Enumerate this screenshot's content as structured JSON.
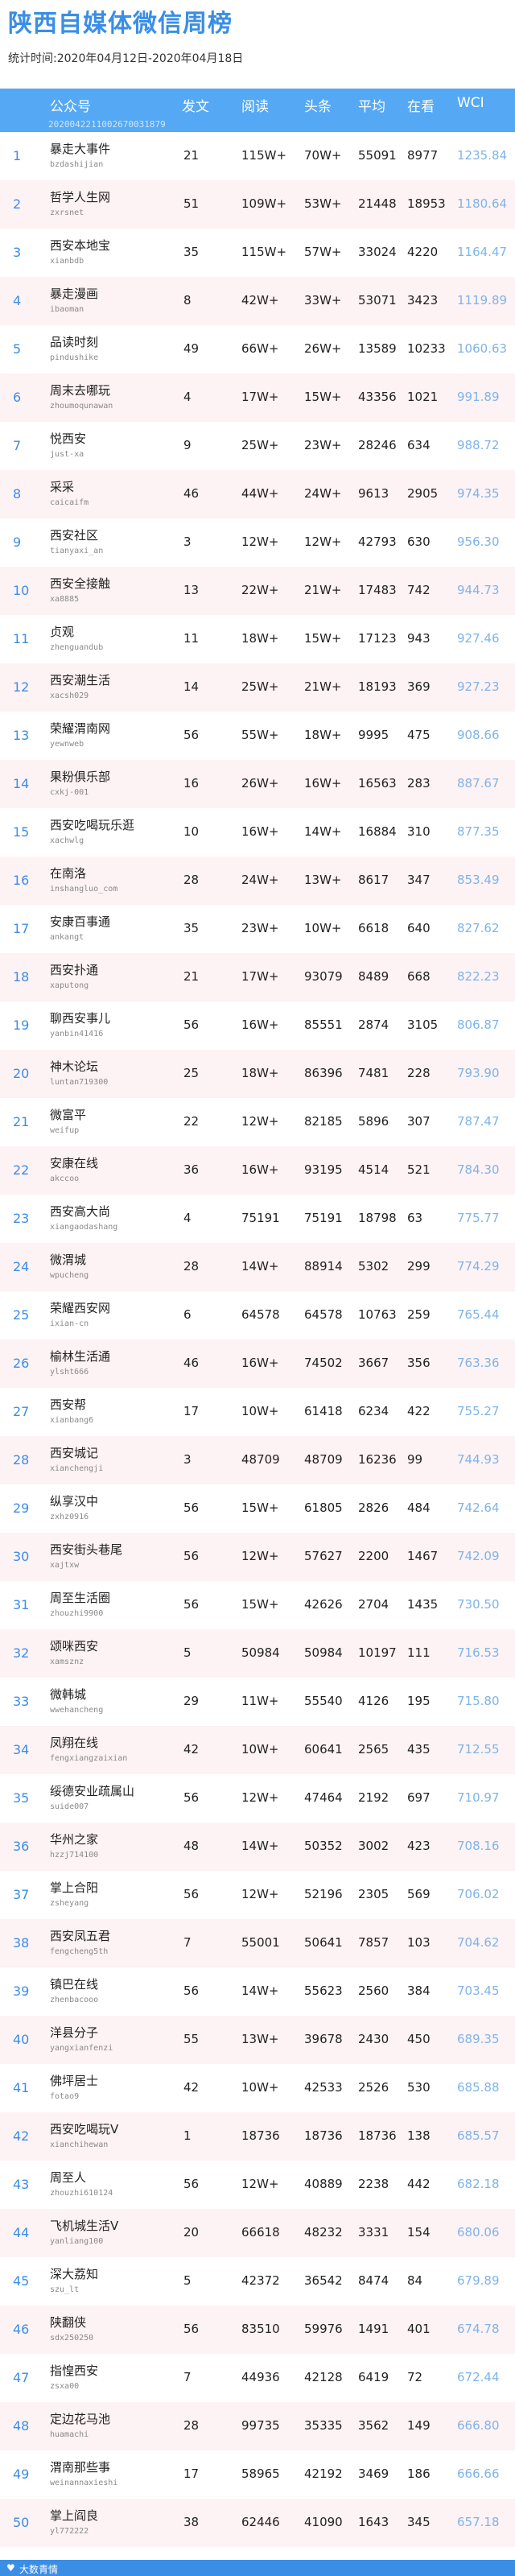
{
  "header": {
    "title": "陕西自媒体微信周榜",
    "period": "统计时间:2020年04月12日-2020年04月18日"
  },
  "table": {
    "columns": {
      "account": "公众号",
      "posts": "发文",
      "reads": "阅读",
      "headline": "头条",
      "average": "平均",
      "watching": "在看",
      "wci": "WCI"
    },
    "code": "2020042211002670031879",
    "rows": [
      {
        "rank": "1",
        "name": "暴走大事件",
        "account": "bzdashijian",
        "posts": "21",
        "reads": "115W+",
        "headline": "70W+",
        "average": "55091",
        "watching": "8977",
        "wci": "1235.84"
      },
      {
        "rank": "2",
        "name": "哲学人生网",
        "account": "zxrsnet",
        "posts": "51",
        "reads": "109W+",
        "headline": "53W+",
        "average": "21448",
        "watching": "18953",
        "wci": "1180.64"
      },
      {
        "rank": "3",
        "name": "西安本地宝",
        "account": "xianbdb",
        "posts": "35",
        "reads": "115W+",
        "headline": "57W+",
        "average": "33024",
        "watching": "4220",
        "wci": "1164.47"
      },
      {
        "rank": "4",
        "name": "暴走漫画",
        "account": "ibaoman",
        "posts": "8",
        "reads": "42W+",
        "headline": "33W+",
        "average": "53071",
        "watching": "3423",
        "wci": "1119.89"
      },
      {
        "rank": "5",
        "name": "品读时刻",
        "account": "pindushike",
        "posts": "49",
        "reads": "66W+",
        "headline": "26W+",
        "average": "13589",
        "watching": "10233",
        "wci": "1060.63"
      },
      {
        "rank": "6",
        "name": "周末去哪玩",
        "account": "zhoumoqunawan",
        "posts": "4",
        "reads": "17W+",
        "headline": "15W+",
        "average": "43356",
        "watching": "1021",
        "wci": "991.89"
      },
      {
        "rank": "7",
        "name": "悦西安",
        "account": "just-xa",
        "posts": "9",
        "reads": "25W+",
        "headline": "23W+",
        "average": "28246",
        "watching": "634",
        "wci": "988.72"
      },
      {
        "rank": "8",
        "name": "采采",
        "account": "caicaifm",
        "posts": "46",
        "reads": "44W+",
        "headline": "24W+",
        "average": "9613",
        "watching": "2905",
        "wci": "974.35"
      },
      {
        "rank": "9",
        "name": "西安社区",
        "account": "tianyaxi_an",
        "posts": "3",
        "reads": "12W+",
        "headline": "12W+",
        "average": "42793",
        "watching": "630",
        "wci": "956.30"
      },
      {
        "rank": "10",
        "name": "西安全接触",
        "account": "xa8885",
        "posts": "13",
        "reads": "22W+",
        "headline": "21W+",
        "average": "17483",
        "watching": "742",
        "wci": "944.73"
      },
      {
        "rank": "11",
        "name": "贞观",
        "account": "zhenguandub",
        "posts": "11",
        "reads": "18W+",
        "headline": "15W+",
        "average": "17123",
        "watching": "943",
        "wci": "927.46"
      },
      {
        "rank": "12",
        "name": "西安潮生活",
        "account": "xacsh029",
        "posts": "14",
        "reads": "25W+",
        "headline": "21W+",
        "average": "18193",
        "watching": "369",
        "wci": "927.23"
      },
      {
        "rank": "13",
        "name": "荣耀渭南网",
        "account": "yewnweb",
        "posts": "56",
        "reads": "55W+",
        "headline": "18W+",
        "average": "9995",
        "watching": "475",
        "wci": "908.66"
      },
      {
        "rank": "14",
        "name": "果粉俱乐部",
        "account": "cxkj-001",
        "posts": "16",
        "reads": "26W+",
        "headline": "16W+",
        "average": "16563",
        "watching": "283",
        "wci": "887.67"
      },
      {
        "rank": "15",
        "name": "西安吃喝玩乐逛",
        "account": "xachwlg",
        "posts": "10",
        "reads": "16W+",
        "headline": "14W+",
        "average": "16884",
        "watching": "310",
        "wci": "877.35"
      },
      {
        "rank": "16",
        "name": "在南洛",
        "account": "inshangluo_com",
        "posts": "28",
        "reads": "24W+",
        "headline": "13W+",
        "average": "8617",
        "watching": "347",
        "wci": "853.49"
      },
      {
        "rank": "17",
        "name": "安康百事通",
        "account": "ankangt",
        "posts": "35",
        "reads": "23W+",
        "headline": "10W+",
        "average": "6618",
        "watching": "640",
        "wci": "827.62"
      },
      {
        "rank": "18",
        "name": "西安扑通",
        "account": "xaputong",
        "posts": "21",
        "reads": "17W+",
        "headline": "93079",
        "average": "8489",
        "watching": "668",
        "wci": "822.23"
      },
      {
        "rank": "19",
        "name": "聊西安事儿",
        "account": "yanbin41416",
        "posts": "56",
        "reads": "16W+",
        "headline": "85551",
        "average": "2874",
        "watching": "3105",
        "wci": "806.87"
      },
      {
        "rank": "20",
        "name": "神木论坛",
        "account": "luntan719300",
        "posts": "25",
        "reads": "18W+",
        "headline": "86396",
        "average": "7481",
        "watching": "228",
        "wci": "793.90"
      },
      {
        "rank": "21",
        "name": "微富平",
        "account": "weifup",
        "posts": "22",
        "reads": "12W+",
        "headline": "82185",
        "average": "5896",
        "watching": "307",
        "wci": "787.47"
      },
      {
        "rank": "22",
        "name": "安康在线",
        "account": "akccoo",
        "posts": "36",
        "reads": "16W+",
        "headline": "93195",
        "average": "4514",
        "watching": "521",
        "wci": "784.30"
      },
      {
        "rank": "23",
        "name": "西安高大尚",
        "account": "xiangaodashang",
        "posts": "4",
        "reads": "75191",
        "headline": "75191",
        "average": "18798",
        "watching": "63",
        "wci": "775.77"
      },
      {
        "rank": "24",
        "name": "微渭城",
        "account": "wpucheng",
        "posts": "28",
        "reads": "14W+",
        "headline": "88914",
        "average": "5302",
        "watching": "299",
        "wci": "774.29"
      },
      {
        "rank": "25",
        "name": "荣耀西安网",
        "account": "ixian-cn",
        "posts": "6",
        "reads": "64578",
        "headline": "64578",
        "average": "10763",
        "watching": "259",
        "wci": "765.44"
      },
      {
        "rank": "26",
        "name": "榆林生活通",
        "account": "ylsht666",
        "posts": "46",
        "reads": "16W+",
        "headline": "74502",
        "average": "3667",
        "watching": "356",
        "wci": "763.36"
      },
      {
        "rank": "27",
        "name": "西安帮",
        "account": "xianbang6",
        "posts": "17",
        "reads": "10W+",
        "headline": "61418",
        "average": "6234",
        "watching": "422",
        "wci": "755.27"
      },
      {
        "rank": "28",
        "name": "西安城记",
        "account": "xianchengji",
        "posts": "3",
        "reads": "48709",
        "headline": "48709",
        "average": "16236",
        "watching": "99",
        "wci": "744.93"
      },
      {
        "rank": "29",
        "name": "纵享汉中",
        "account": "zxhz0916",
        "posts": "56",
        "reads": "15W+",
        "headline": "61805",
        "average": "2826",
        "watching": "484",
        "wci": "742.64"
      },
      {
        "rank": "30",
        "name": "西安街头巷尾",
        "account": "xajtxw",
        "posts": "56",
        "reads": "12W+",
        "headline": "57627",
        "average": "2200",
        "watching": "1467",
        "wci": "742.09"
      },
      {
        "rank": "31",
        "name": "周至生活圈",
        "account": "zhouzhi9900",
        "posts": "56",
        "reads": "15W+",
        "headline": "42626",
        "average": "2704",
        "watching": "1435",
        "wci": "730.50"
      },
      {
        "rank": "32",
        "name": "颂咪西安",
        "account": "xamsznz",
        "posts": "5",
        "reads": "50984",
        "headline": "50984",
        "average": "10197",
        "watching": "111",
        "wci": "716.53"
      },
      {
        "rank": "33",
        "name": "微韩城",
        "account": "wwehancheng",
        "posts": "29",
        "reads": "11W+",
        "headline": "55540",
        "average": "4126",
        "watching": "195",
        "wci": "715.80"
      },
      {
        "rank": "34",
        "name": "凤翔在线",
        "account": "fengxiangzaixian",
        "posts": "42",
        "reads": "10W+",
        "headline": "60641",
        "average": "2565",
        "watching": "435",
        "wci": "712.55"
      },
      {
        "rank": "35",
        "name": "绥德安业疏属山",
        "account": "suide007",
        "posts": "56",
        "reads": "12W+",
        "headline": "47464",
        "average": "2192",
        "watching": "697",
        "wci": "710.97"
      },
      {
        "rank": "36",
        "name": "华州之家",
        "account": "hzzj714100",
        "posts": "48",
        "reads": "14W+",
        "headline": "50352",
        "average": "3002",
        "watching": "423",
        "wci": "708.16"
      },
      {
        "rank": "37",
        "name": "掌上合阳",
        "account": "zsheyang",
        "posts": "56",
        "reads": "12W+",
        "headline": "52196",
        "average": "2305",
        "watching": "569",
        "wci": "706.02"
      },
      {
        "rank": "38",
        "name": "西安凤五君",
        "account": "fengcheng5th",
        "posts": "7",
        "reads": "55001",
        "headline": "50641",
        "average": "7857",
        "watching": "103",
        "wci": "704.62"
      },
      {
        "rank": "39",
        "name": "镇巴在线",
        "account": "zhenbacooo",
        "posts": "56",
        "reads": "14W+",
        "headline": "55623",
        "average": "2560",
        "watching": "384",
        "wci": "703.45"
      },
      {
        "rank": "40",
        "name": "洋县分子",
        "account": "yangxianfenzi",
        "posts": "55",
        "reads": "13W+",
        "headline": "39678",
        "average": "2430",
        "watching": "450",
        "wci": "689.35"
      },
      {
        "rank": "41",
        "name": "佛坪居士",
        "account": "fotao9",
        "posts": "42",
        "reads": "10W+",
        "headline": "42533",
        "average": "2526",
        "watching": "530",
        "wci": "685.88"
      },
      {
        "rank": "42",
        "name": "西安吃喝玩V",
        "account": "xianchihewan",
        "posts": "1",
        "reads": "18736",
        "headline": "18736",
        "average": "18736",
        "watching": "138",
        "wci": "685.57"
      },
      {
        "rank": "43",
        "name": "周至人",
        "account": "zhouzhi610124",
        "posts": "56",
        "reads": "12W+",
        "headline": "40889",
        "average": "2238",
        "watching": "442",
        "wci": "682.18"
      },
      {
        "rank": "44",
        "name": "飞机城生活V",
        "account": "yanliang100",
        "posts": "20",
        "reads": "66618",
        "headline": "48232",
        "average": "3331",
        "watching": "154",
        "wci": "680.06"
      },
      {
        "rank": "45",
        "name": "深大荔知",
        "account": "szu_lt",
        "posts": "5",
        "reads": "42372",
        "headline": "36542",
        "average": "8474",
        "watching": "84",
        "wci": "679.89"
      },
      {
        "rank": "46",
        "name": "陕翻侠",
        "account": "sdx250250",
        "posts": "56",
        "reads": "83510",
        "headline": "59976",
        "average": "1491",
        "watching": "401",
        "wci": "674.78"
      },
      {
        "rank": "47",
        "name": "指惶西安",
        "account": "zsxa00",
        "posts": "7",
        "reads": "44936",
        "headline": "42128",
        "average": "6419",
        "watching": "72",
        "wci": "672.44"
      },
      {
        "rank": "48",
        "name": "定边花马池",
        "account": "huamachi",
        "posts": "28",
        "reads": "99735",
        "headline": "35335",
        "average": "3562",
        "watching": "149",
        "wci": "666.80"
      },
      {
        "rank": "49",
        "name": "渭南那些事",
        "account": "weinannaxieshi",
        "posts": "17",
        "reads": "58965",
        "headline": "42192",
        "average": "3469",
        "watching": "186",
        "wci": "666.66"
      },
      {
        "rank": "50",
        "name": "掌上阎良",
        "account": "yl772222",
        "posts": "38",
        "reads": "62446",
        "headline": "41090",
        "average": "1643",
        "watching": "345",
        "wci": "657.18"
      }
    ]
  },
  "footer": {
    "brand": "大数青情",
    "logo_icon": "heart-icon"
  },
  "colors": {
    "title": "#3a8ee6",
    "header_bg": "#55a8f3",
    "alt_row": "#fdf2f4",
    "wci_text": "#7fb4e8",
    "footer_bg": "#3a8ee6"
  }
}
